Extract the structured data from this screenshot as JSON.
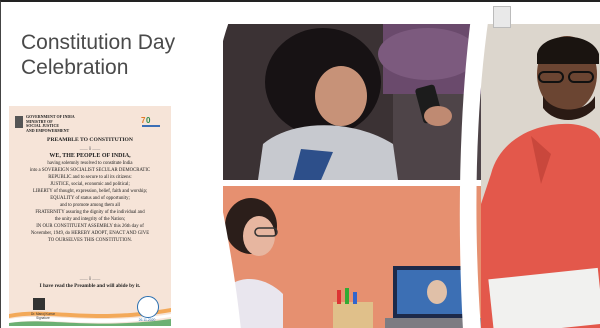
{
  "slide": {
    "title": "Constitution Day\nCelebration"
  },
  "preamble": {
    "ministry": "GOVERNMENT OF INDIA\nMINISTRY OF\nSOCIAL JUSTICE\nAND EMPOWERMENT",
    "logo": "70 years",
    "title": "PREAMBLE TO CONSTITUTION",
    "divider": "—— oͤ ——",
    "lines": [
      "WE, THE PEOPLE OF INDIA,",
      "having solemnly resolved to constitute India",
      "into a SOVEREIGN SOCIALIST SECULAR DEMOCRATIC",
      "REPUBLIC and to secure to all its citizens:",
      "JUSTICE, social, economic and political;",
      "LIBERTY of thought, expression, belief, faith and worship;",
      "EQUALITY of status and of opportunity;",
      "and to promote among them all",
      "FRATERNITY assuring the dignity of the individual and",
      "the unity and integrity of the Nation;",
      "IN OUR CONSTITUENT ASSEMBLY this 26th day of",
      "November, 1949, do HEREBY ADOPT, ENACT AND GIVE",
      "TO OURSELVES THIS CONSTITUTION."
    ],
    "pledge": "I have read the Preamble and will abide by it.",
    "signatory": "Dr. Manoj Kumar\nSignature",
    "badge_date": "26.11.2020"
  },
  "colors": {
    "title": "#4a4a4a",
    "document_bg": "#f6e4d8",
    "wall": "#e58f6d",
    "shirt": "#e1574a"
  }
}
